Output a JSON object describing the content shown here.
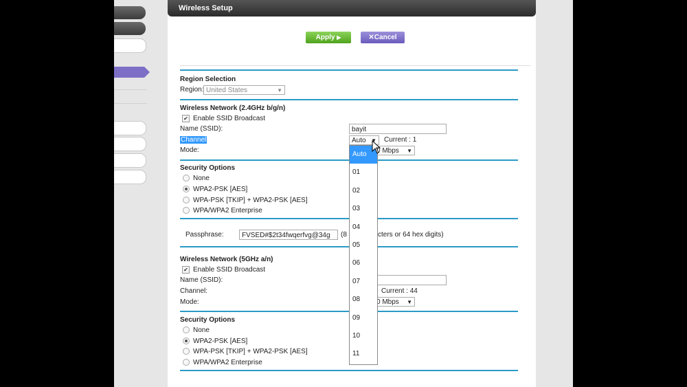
{
  "panel": {
    "title": "Wireless Setup"
  },
  "buttons": {
    "apply": "Apply",
    "apply_arrow": "▶",
    "cancel": "Cancel",
    "cancel_icon": "✕"
  },
  "region": {
    "heading": "Region Selection",
    "label": "Region:",
    "value": "United States"
  },
  "wn24": {
    "heading": "Wireless Network (2.4GHz b/g/n)",
    "enable_ssid": "Enable SSID Broadcast",
    "name_label": "Name (SSID):",
    "name_value": "bayit",
    "channel_label": "Channel",
    "channel_value": "Auto",
    "current_label": "Current :",
    "current_value": "1",
    "mode_label": "Mode:",
    "mode_value": "0 Mbps"
  },
  "security1": {
    "heading": "Security Options",
    "options": [
      "None",
      "WPA2-PSK [AES]",
      "WPA-PSK [TKIP] + WPA2-PSK [AES]",
      "WPA/WPA2 Enterprise"
    ],
    "selected": "WPA2-PSK [AES]"
  },
  "passphrase": {
    "label": "Passphrase:",
    "value": "FVSED#$2t34fwqerfvg@34g",
    "hint_start": "(8",
    "hint_end": "cters or 64 hex digits)"
  },
  "wn5": {
    "heading": "Wireless Network (5GHz a/n)",
    "enable_ssid": "Enable SSID Broadcast",
    "name_label": "Name (SSID):",
    "channel_label": "Channel:",
    "current_label": "Current :",
    "current_value": "44",
    "mode_label": "Mode:",
    "mode_value": "0 Mbps"
  },
  "security2": {
    "heading": "Security Options",
    "options": [
      "None",
      "WPA2-PSK [AES]",
      "WPA-PSK [TKIP] + WPA2-PSK [AES]",
      "WPA/WPA2 Enterprise"
    ],
    "selected": "WPA2-PSK [AES]"
  },
  "channel_dropdown": {
    "options": [
      "Auto",
      "01",
      "02",
      "03",
      "04",
      "05",
      "06",
      "07",
      "08",
      "09",
      "10",
      "11"
    ],
    "selected": "Auto"
  }
}
